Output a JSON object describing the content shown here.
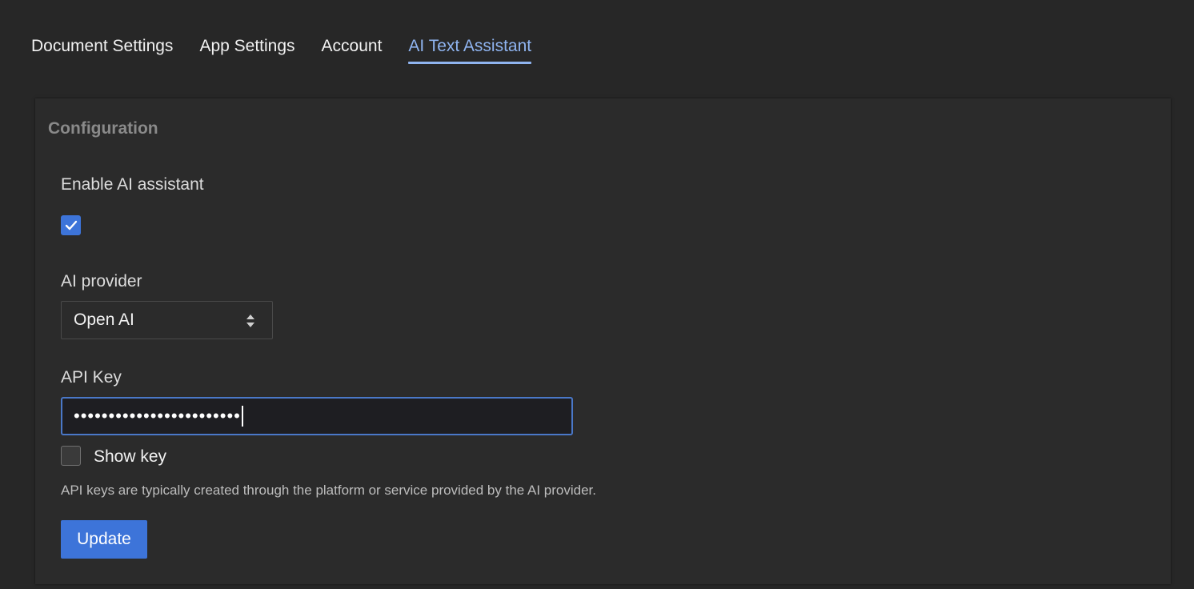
{
  "tabs": [
    {
      "label": "Document Settings",
      "active": false
    },
    {
      "label": "App Settings",
      "active": false
    },
    {
      "label": "Account",
      "active": false
    },
    {
      "label": "AI Text Assistant",
      "active": true
    }
  ],
  "section": {
    "title": "Configuration"
  },
  "enable_ai": {
    "label": "Enable AI assistant",
    "checked": true
  },
  "provider": {
    "label": "AI provider",
    "value": "Open AI"
  },
  "api_key": {
    "label": "API Key",
    "masked_value": "••••••••••••••••••••••••"
  },
  "show_key": {
    "label": "Show key",
    "checked": false
  },
  "hint": "API keys are typically created through the platform or service provided by the AI provider.",
  "update_button": "Update",
  "colors": {
    "accent": "#3d74d9",
    "active_tab": "#8fb4f0",
    "background": "#272727"
  }
}
